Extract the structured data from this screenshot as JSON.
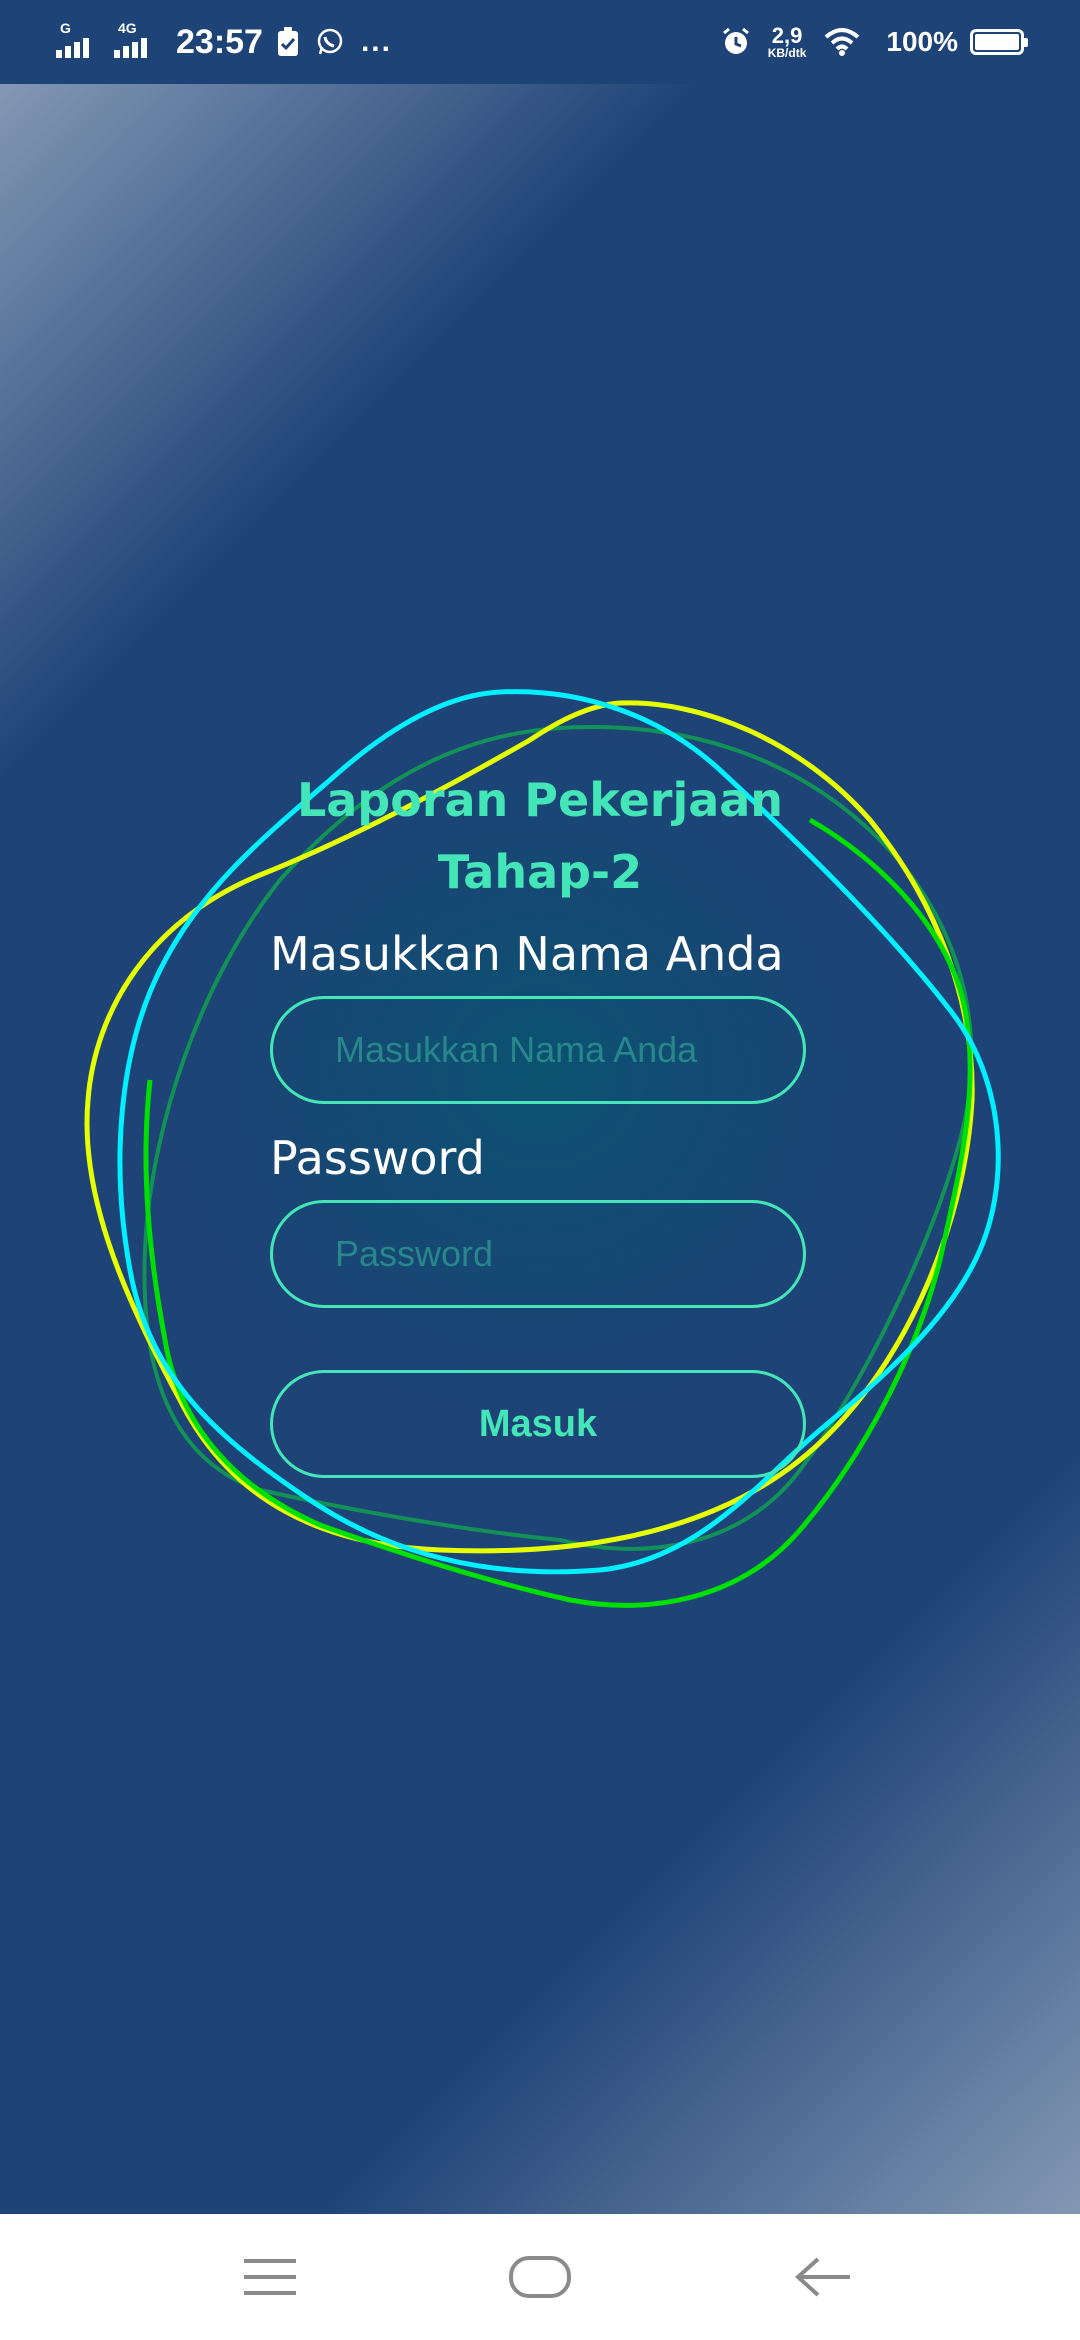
{
  "status_bar": {
    "network_1": "G",
    "network_2": "4G",
    "time": "23:57",
    "speed_value": "2,9",
    "speed_unit": "KB/dtk",
    "battery": "100%",
    "more_icon": "..."
  },
  "form": {
    "title": "Laporan Pekerjaan Tahap-2",
    "name_label": "Masukkan Nama Anda",
    "name_placeholder": "Masukkan Nama Anda",
    "password_label": "Password",
    "password_placeholder": "Password",
    "submit_label": "Masuk"
  },
  "colors": {
    "background": "#1e4377",
    "accent": "#44e6b8",
    "ring_cyan": "#00f0ff",
    "ring_yellow": "#e6ff00",
    "ring_green": "#00e000"
  },
  "icons": {
    "status": [
      "signal-icon",
      "signal-icon",
      "battery-check-icon",
      "whatsapp-icon",
      "more-icon",
      "alarm-icon",
      "wifi-icon",
      "battery-icon"
    ],
    "nav": [
      "menu-icon",
      "home-icon",
      "back-icon"
    ]
  }
}
